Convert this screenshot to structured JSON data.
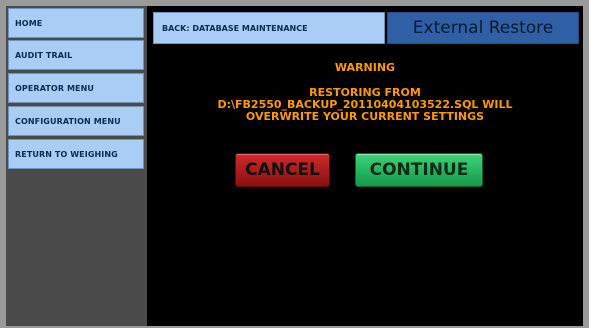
{
  "sidebar": {
    "items": [
      {
        "label": "HOME"
      },
      {
        "label": "AUDIT TRAIL"
      },
      {
        "label": "OPERATOR MENU"
      },
      {
        "label": "CONFIGURATION MENU"
      },
      {
        "label": "RETURN TO WEIGHING"
      }
    ]
  },
  "header": {
    "back_label": "BACK: DATABASE MAINTENANCE",
    "title": "External Restore"
  },
  "warning": {
    "heading": "WARNING",
    "line1": "RESTORING FROM",
    "line2": "D:\\FB2550_BACKUP_20110404103522.SQL WILL",
    "line3": "OVERWRITE YOUR CURRENT SETTINGS"
  },
  "actions": {
    "cancel_label": "CANCEL",
    "continue_label": "CONTINUE"
  },
  "colors": {
    "nav_button": "#a9cdf4",
    "title_bar": "#2f5fa4",
    "warning_text": "#ff9a00",
    "cancel": "#b21e1e",
    "continue": "#22b85e"
  }
}
